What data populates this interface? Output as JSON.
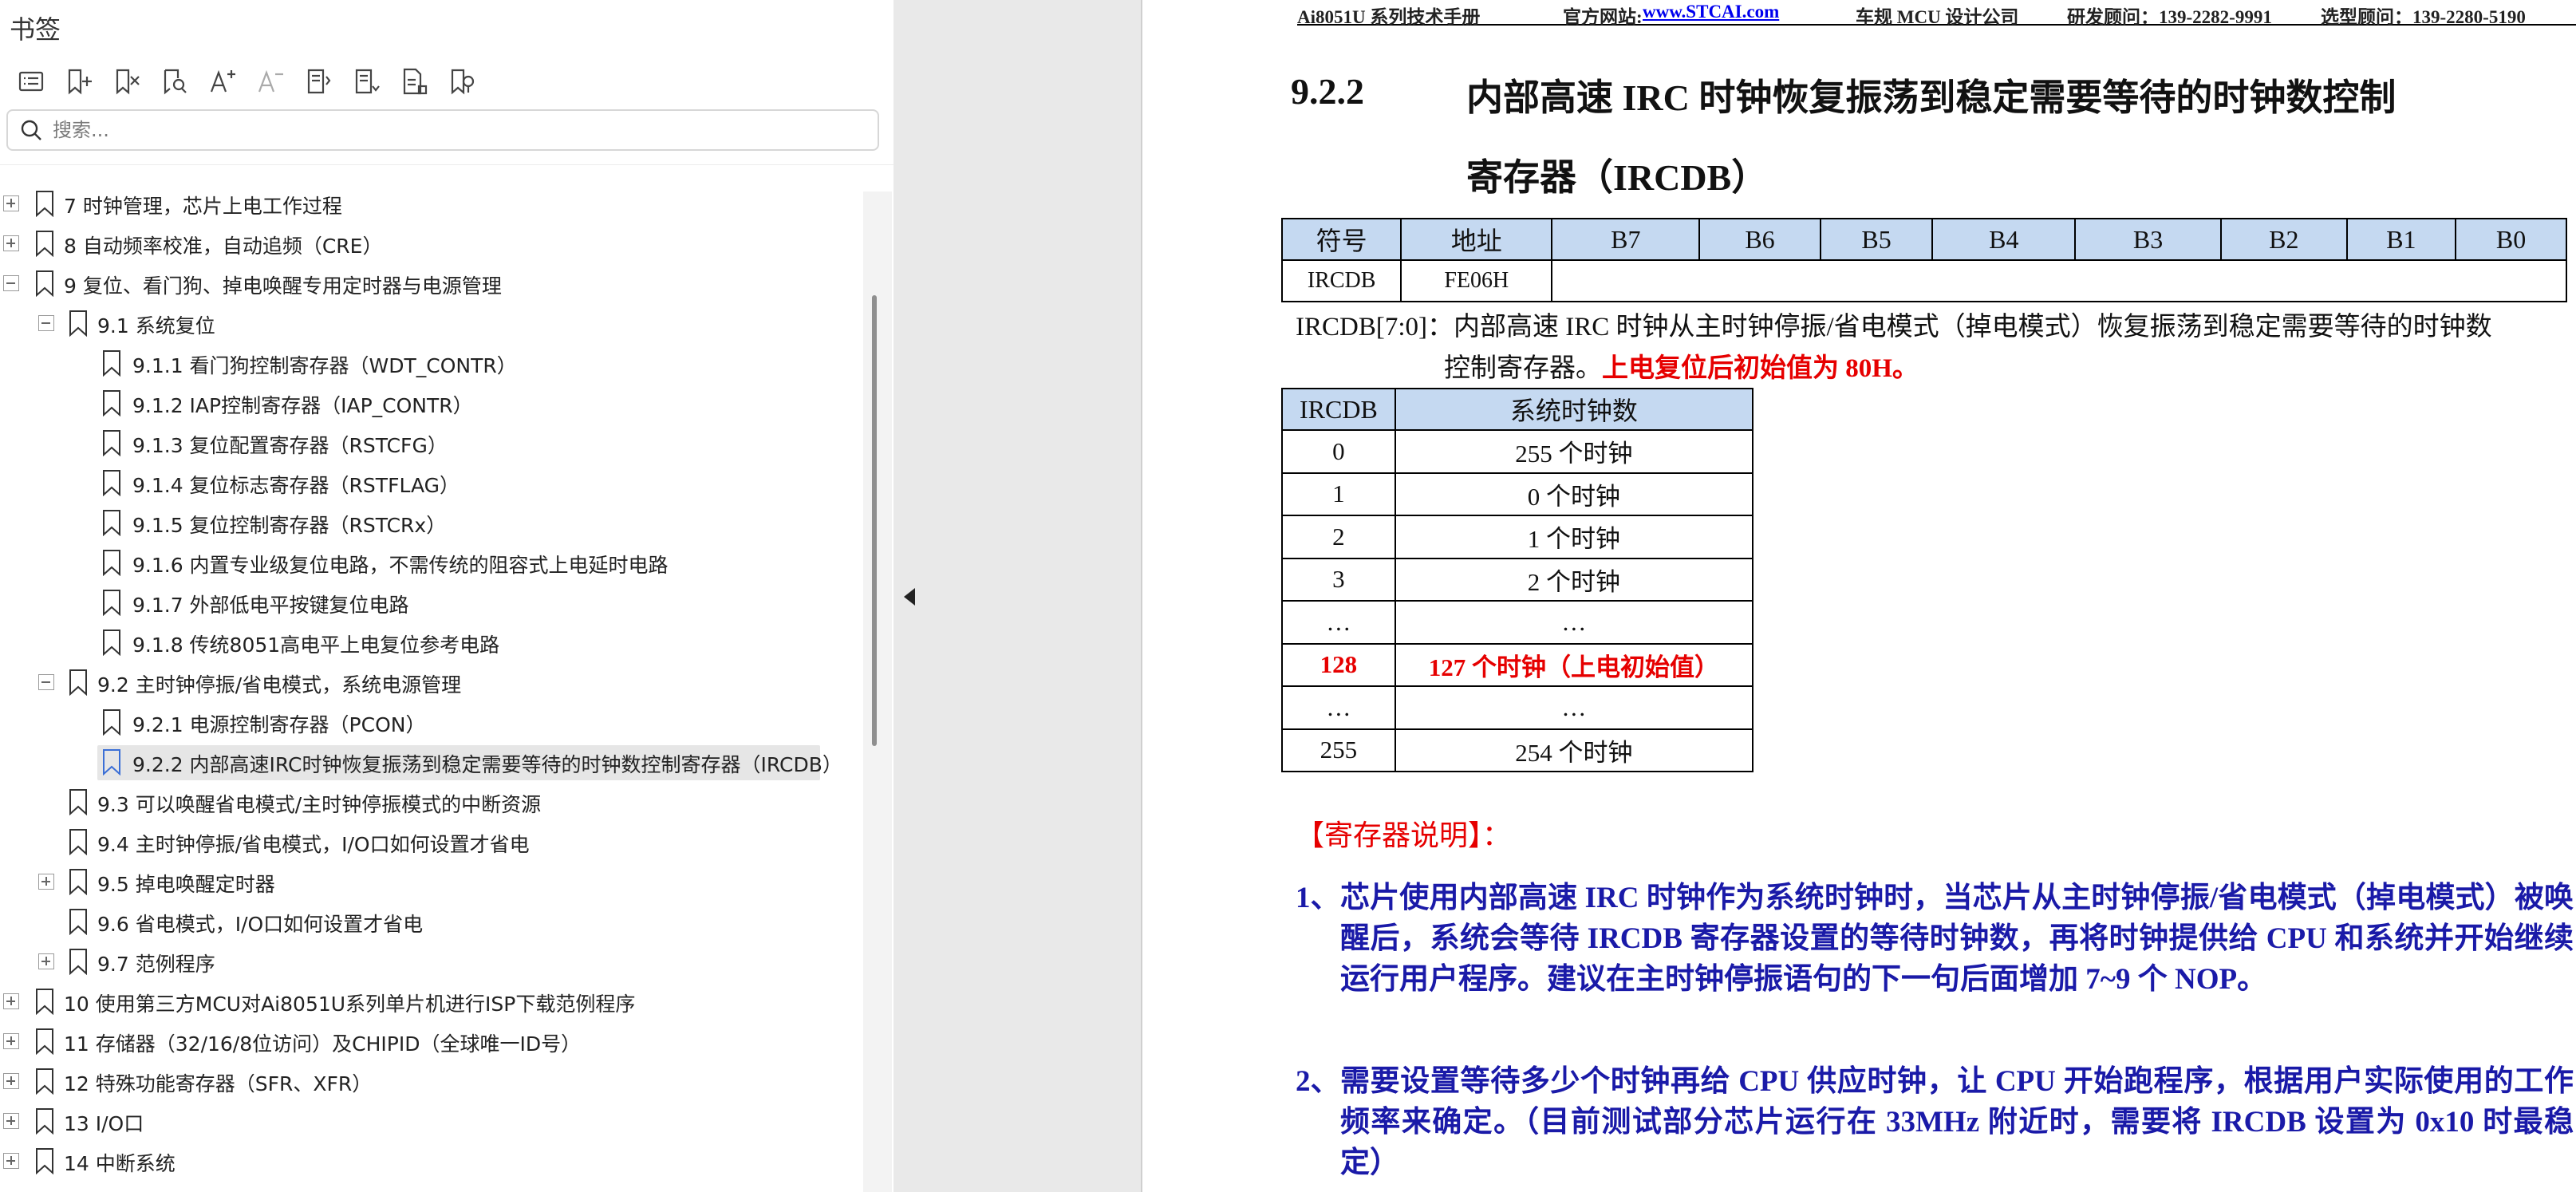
{
  "panel": {
    "title": "书签",
    "search_placeholder": "搜索..."
  },
  "toolbar": [
    {
      "name": "bookmark-list-icon"
    },
    {
      "name": "add-bookmark-icon"
    },
    {
      "name": "delete-bookmark-icon"
    },
    {
      "name": "find-bookmark-icon"
    },
    {
      "name": "increase-font-icon"
    },
    {
      "name": "decrease-font-icon"
    },
    {
      "name": "expand-all-icon"
    },
    {
      "name": "collapse-all-icon"
    },
    {
      "name": "bookmark-properties-icon"
    },
    {
      "name": "bookmark-location-icon"
    }
  ],
  "tree": [
    {
      "label": "7  时钟管理，芯片上电工作过程",
      "level": 0,
      "expander": "plus"
    },
    {
      "label": "8  自动频率校准，自动追频（CRE）",
      "level": 0,
      "expander": "plus"
    },
    {
      "label": "9  复位、看门狗、掉电唤醒专用定时器与电源管理",
      "level": 0,
      "expander": "minus"
    },
    {
      "label": "9.1 系统复位",
      "level": 1,
      "expander": "minus"
    },
    {
      "label": "9.1.1  看门狗控制寄存器（WDT_CONTR）",
      "level": 2,
      "expander": "none"
    },
    {
      "label": "9.1.2  IAP控制寄存器（IAP_CONTR）",
      "level": 2,
      "expander": "none"
    },
    {
      "label": "9.1.3 复位配置寄存器（RSTCFG）",
      "level": 2,
      "expander": "none"
    },
    {
      "label": "9.1.4  复位标志寄存器（RSTFLAG）",
      "level": 2,
      "expander": "none"
    },
    {
      "label": "9.1.5  复位控制寄存器（RSTCRx）",
      "level": 2,
      "expander": "none"
    },
    {
      "label": "9.1.6  内置专业级复位电路，不需传统的阻容式上电延时电路",
      "level": 2,
      "expander": "none"
    },
    {
      "label": "9.1.7 外部低电平按键复位电路",
      "level": 2,
      "expander": "none"
    },
    {
      "label": "9.1.8 传统8051高电平上电复位参考电路",
      "level": 2,
      "expander": "none"
    },
    {
      "label": "9.2  主时钟停振/省电模式，系统电源管理",
      "level": 1,
      "expander": "minus"
    },
    {
      "label": "9.2.1 电源控制寄存器（PCON）",
      "level": 2,
      "expander": "none"
    },
    {
      "label": "9.2.2  内部高速IRC时钟恢复振荡到稳定需要等待的时钟数控制寄存器（IRCDB）",
      "level": 2,
      "expander": "none",
      "selected": true
    },
    {
      "label": "9.3  可以唤醒省电模式/主时钟停振模式的中断资源",
      "level": 1,
      "expander": "none"
    },
    {
      "label": "9.4  主时钟停振/省电模式，I/O口如何设置才省电",
      "level": 1,
      "expander": "none"
    },
    {
      "label": "9.5  掉电唤醒定时器",
      "level": 1,
      "expander": "plus"
    },
    {
      "label": "9.6  省电模式，I/O口如何设置才省电",
      "level": 1,
      "expander": "none"
    },
    {
      "label": "9.7  范例程序",
      "level": 1,
      "expander": "plus"
    },
    {
      "label": "10  使用第三方MCU对Ai8051U系列单片机进行ISP下载范例程序",
      "level": 0,
      "expander": "plus"
    },
    {
      "label": "11  存储器（32/16/8位访问）及CHIPID（全球唯一ID号）",
      "level": 0,
      "expander": "plus"
    },
    {
      "label": "12  特殊功能寄存器（SFR、XFR）",
      "level": 0,
      "expander": "plus"
    },
    {
      "label": "13  I/O口",
      "level": 0,
      "expander": "plus"
    },
    {
      "label": "14  中断系统",
      "level": 0,
      "expander": "plus"
    }
  ],
  "doc": {
    "header": {
      "manual": "Ai8051U 系列技术手册",
      "site_label": "官方网站:",
      "site_link": "www.STCAI.com",
      "company": "车规 MCU 设计公司",
      "advisor1": "研发顾问：139-2282-9991",
      "advisor2": "选型顾问：139-2280-5190"
    },
    "section_number": "9.2.2",
    "section_title_line1": "内部高速 IRC 时钟恢复振荡到稳定需要等待的时钟数控制",
    "section_title_line2": "寄存器（IRCDB）",
    "reg_table": {
      "headers": [
        "符号",
        "地址",
        "B7",
        "B6",
        "B5",
        "B4",
        "B3",
        "B2",
        "B1",
        "B0"
      ],
      "symbol": "IRCDB",
      "address": "FE06H"
    },
    "reg_desc_line1": "IRCDB[7:0]：内部高速 IRC 时钟从主时钟停振/省电模式（掉电模式）恢复振荡到稳定需要等待的时钟数",
    "reg_desc_line2": "控制寄存器。",
    "reg_desc_red": "上电复位后初始值为 80H。",
    "clk_table": {
      "headers": [
        "IRCDB",
        "系统时钟数"
      ],
      "rows": [
        {
          "v": "0",
          "c": "255 个时钟"
        },
        {
          "v": "1",
          "c": "0 个时钟"
        },
        {
          "v": "2",
          "c": "1 个时钟"
        },
        {
          "v": "3",
          "c": "2 个时钟"
        },
        {
          "v": "…",
          "c": "…"
        },
        {
          "v": "128",
          "c": "127 个时钟（上电初始值）",
          "red": true
        },
        {
          "v": "…",
          "c": "…"
        },
        {
          "v": "255",
          "c": "254 个时钟"
        }
      ]
    },
    "notes_title": "【寄存器说明】：",
    "note1_num": "1、",
    "note1_text": "芯片使用内部高速 IRC 时钟作为系统时钟时，当芯片从主时钟停振/省电模式（掉电模式）被唤醒后，系统会等待 IRCDB 寄存器设置的等待时钟数，再将时钟提供给 CPU 和系统并开始继续运行用户程序。建议在主时钟停振语句的下一句后面增加 7~9 个 NOP。",
    "note2_num": "2、",
    "note2_text": "需要设置等待多少个时钟再给 CPU 供应时钟，让 CPU 开始跑程序，根据用户实际使用的工作频率来确定。（目前测试部分芯片运行在 33MHz 附近时，需要将 IRCDB 设置为 0x10 时最稳定）"
  },
  "colors": {
    "table_header_bg": "#c5d9f1",
    "emphasis_red": "#e60000",
    "note_blue": "#1a1aa8",
    "link_blue": "#0000ee",
    "selected_row": "#e6e6e6"
  }
}
